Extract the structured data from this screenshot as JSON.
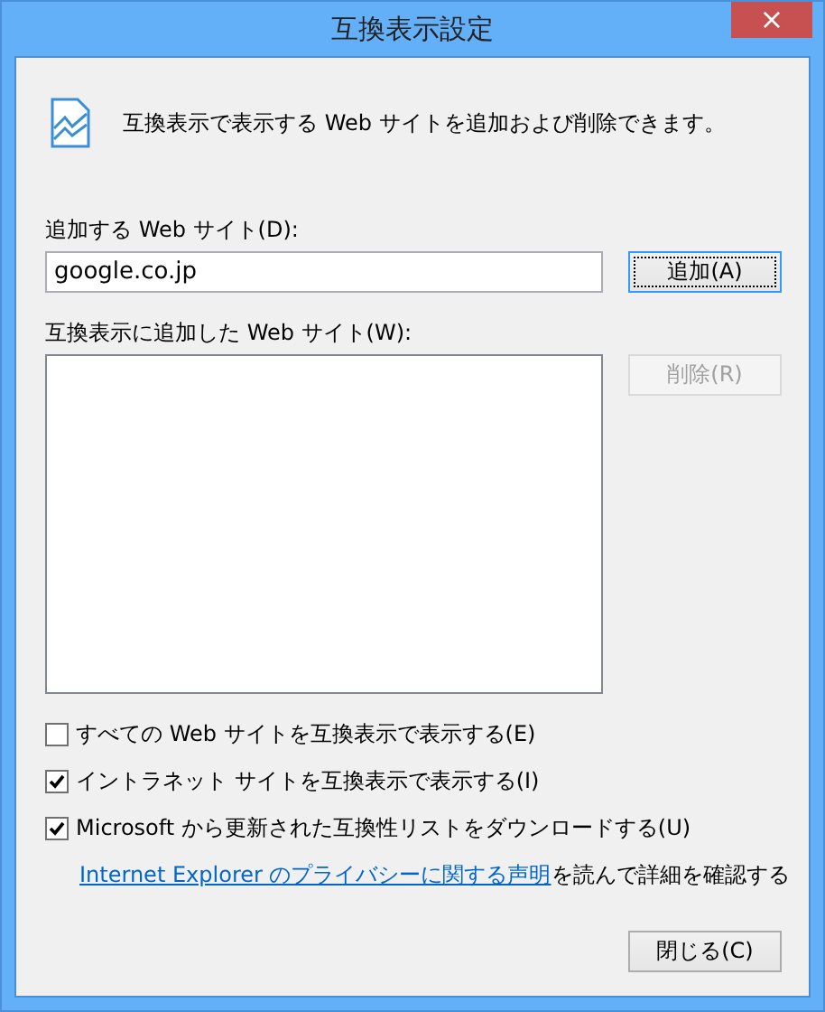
{
  "window": {
    "title": "互換表示設定",
    "close": "×"
  },
  "intro": "互換表示で表示する Web サイトを追加および削除できます。",
  "add_label": "追加する Web サイト(D):",
  "add_field": {
    "value": "google.co.jp"
  },
  "add_button": {
    "label": "追加(A)",
    "disabled": false,
    "focused": true
  },
  "list_label": "互換表示に追加した Web サイト(W):",
  "remove_button": {
    "label": "削除(R)",
    "disabled": true,
    "focused": false
  },
  "options": [
    {
      "label": "すべての Web サイトを互換表示で表示する(E)",
      "checked": false
    },
    {
      "label": "イントラネット サイトを互換表示で表示する(I)",
      "checked": true
    },
    {
      "label": "Microsoft から更新された互換性リストをダウンロードする(U)",
      "checked": true
    }
  ],
  "privacy": {
    "link": "Internet Explorer のプライバシーに関する声明",
    "text": "を読んで詳細を確認する"
  },
  "close_button": {
    "label": "閉じる(C)",
    "disabled": false,
    "focused": false
  }
}
